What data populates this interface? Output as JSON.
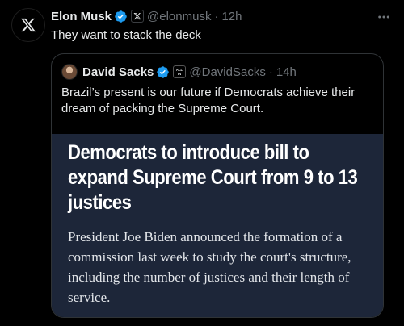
{
  "author": {
    "display_name": "Elon Musk",
    "handle": "@elonmusk",
    "separator": "·",
    "time": "12h",
    "avatar_icon": "x-logo-icon",
    "verified_icon": "verified-badge-icon",
    "affiliation_icon": "x-affiliation-icon"
  },
  "tweet": {
    "text": "They want to stack the deck"
  },
  "quote": {
    "display_name": "David Sacks",
    "handle": "@DavidSacks",
    "separator": "·",
    "time": "14h",
    "affiliation_badge_text": "ALL IN",
    "text": "Brazil’s present is our future if Democrats achieve their dream of packing the Supreme Court.",
    "image": {
      "headline": "Democrats to introduce bill to expand Supreme Court from 9 to 13 justices",
      "body": "President Joe Biden announced the formation of a commission last week to study the court's structure, including the number of justices and their length of service."
    }
  },
  "colors": {
    "background": "#000000",
    "text_primary": "#e7e9ea",
    "text_secondary": "#71767b",
    "verified_blue": "#1d9bf0",
    "border": "#2f3336",
    "image_bg": "#1d2639"
  }
}
